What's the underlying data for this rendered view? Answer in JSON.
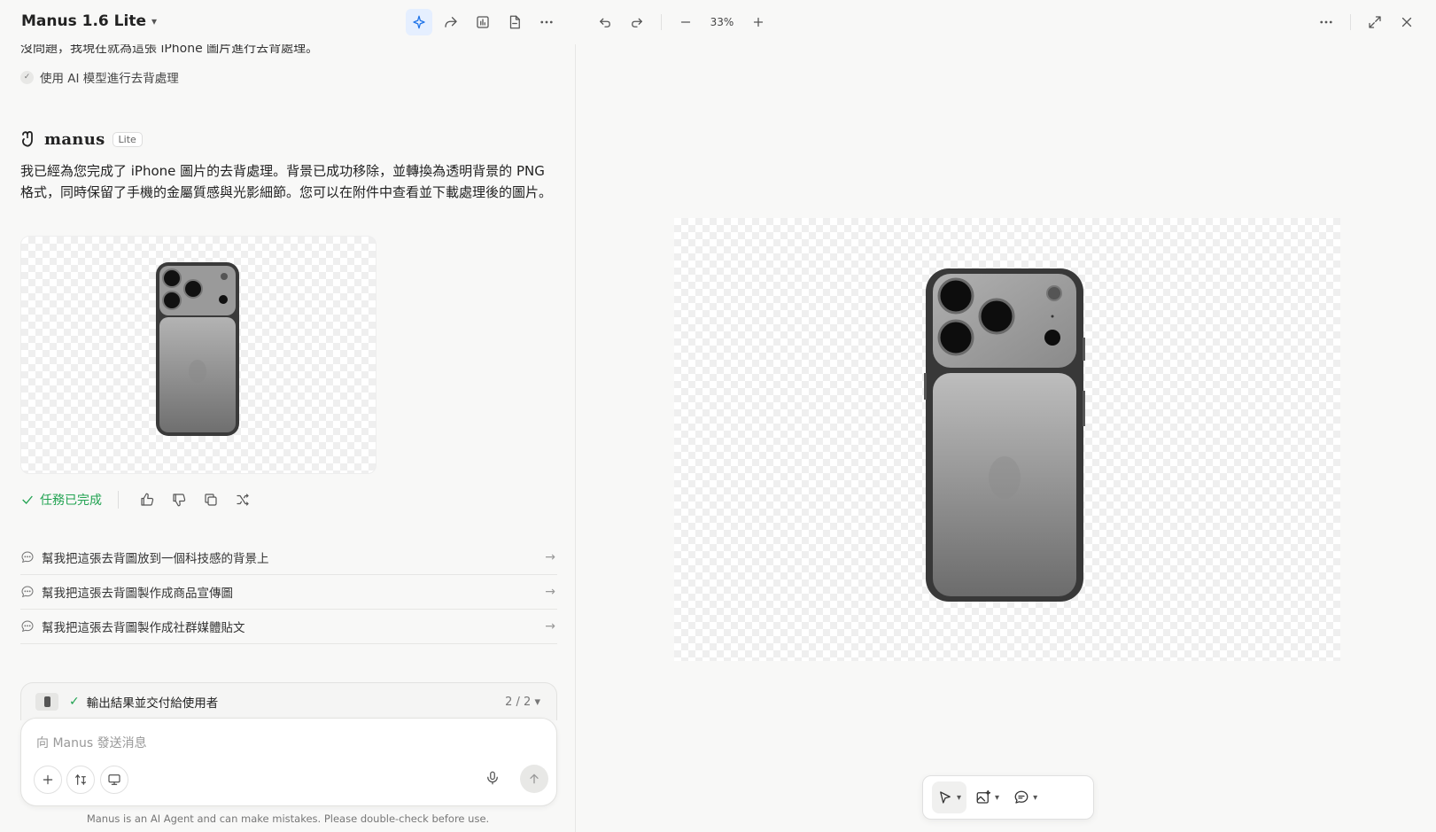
{
  "header": {
    "app_title": "Manus 1.6 Lite"
  },
  "conversation": {
    "previous_reply_tail": "沒問題，我現在就為這張 iPhone 圖片進行去背處理。",
    "step_label": "使用 AI 模型進行去背處理",
    "agent_name": "manus",
    "agent_badge": "Lite",
    "message": "我已經為您完成了 iPhone 圖片的去背處理。背景已成功移除，並轉換為透明背景的 PNG 格式，同時保留了手機的金屬質感與光影細節。您可以在附件中查看並下載處理後的圖片。",
    "status": "任務已完成",
    "suggestions": [
      "幫我把這張去背圖放到一個科技感的背景上",
      "幫我把這張去背圖製作成商品宣傳圖",
      "幫我把這張去背圖製作成社群媒體貼文"
    ]
  },
  "task": {
    "label": "輸出結果並交付給使用者",
    "counter": "2 / 2"
  },
  "composer": {
    "placeholder": "向 Manus 發送消息"
  },
  "disclaimer": "Manus is an AI Agent and can make mistakes. Please double-check before use.",
  "viewer": {
    "zoom": "33%"
  },
  "colors": {
    "accent": "#1e73e8",
    "success": "#22a352",
    "background": "#f8f8f7"
  }
}
